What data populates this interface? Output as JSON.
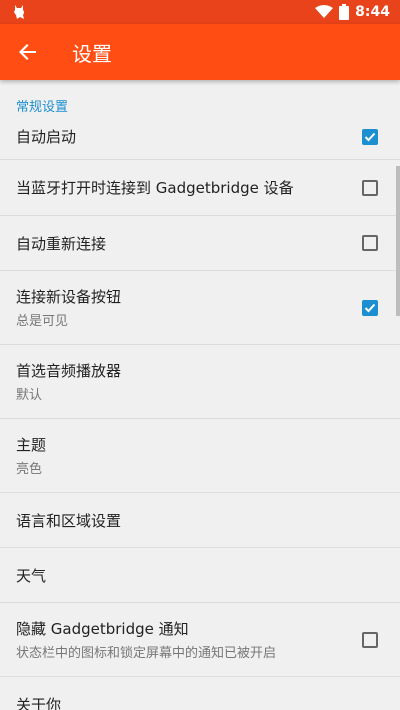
{
  "status": {
    "time": "8:44",
    "app_icon": "cat-notification-icon",
    "wifi_icon": "wifi-icon",
    "battery_icon": "battery-icon"
  },
  "appbar": {
    "title": "设置",
    "back_icon": "arrow-back-icon"
  },
  "section": {
    "title": "常规设置"
  },
  "items": [
    {
      "title": "自动启动",
      "subtitle": "",
      "checkbox": true
    },
    {
      "title": "当蓝牙打开时连接到 Gadgetbridge 设备",
      "subtitle": "",
      "checkbox": false
    },
    {
      "title": "自动重新连接",
      "subtitle": "",
      "checkbox": false
    },
    {
      "title": "连接新设备按钮",
      "subtitle": "总是可见",
      "checkbox": true
    },
    {
      "title": "首选音频播放器",
      "subtitle": "默认"
    },
    {
      "title": "主题",
      "subtitle": "亮色"
    },
    {
      "title": "语言和区域设置",
      "subtitle": ""
    },
    {
      "title": "天气",
      "subtitle": ""
    },
    {
      "title": "隐藏 Gadgetbridge 通知",
      "subtitle": "状态栏中的图标和锁定屏幕中的通知已被开启",
      "checkbox": false
    },
    {
      "title": "关于你",
      "subtitle": ""
    }
  ],
  "colors": {
    "status_bar": "#e8431a",
    "app_bar": "#ff4d14",
    "accent": "#1b8fd0"
  }
}
